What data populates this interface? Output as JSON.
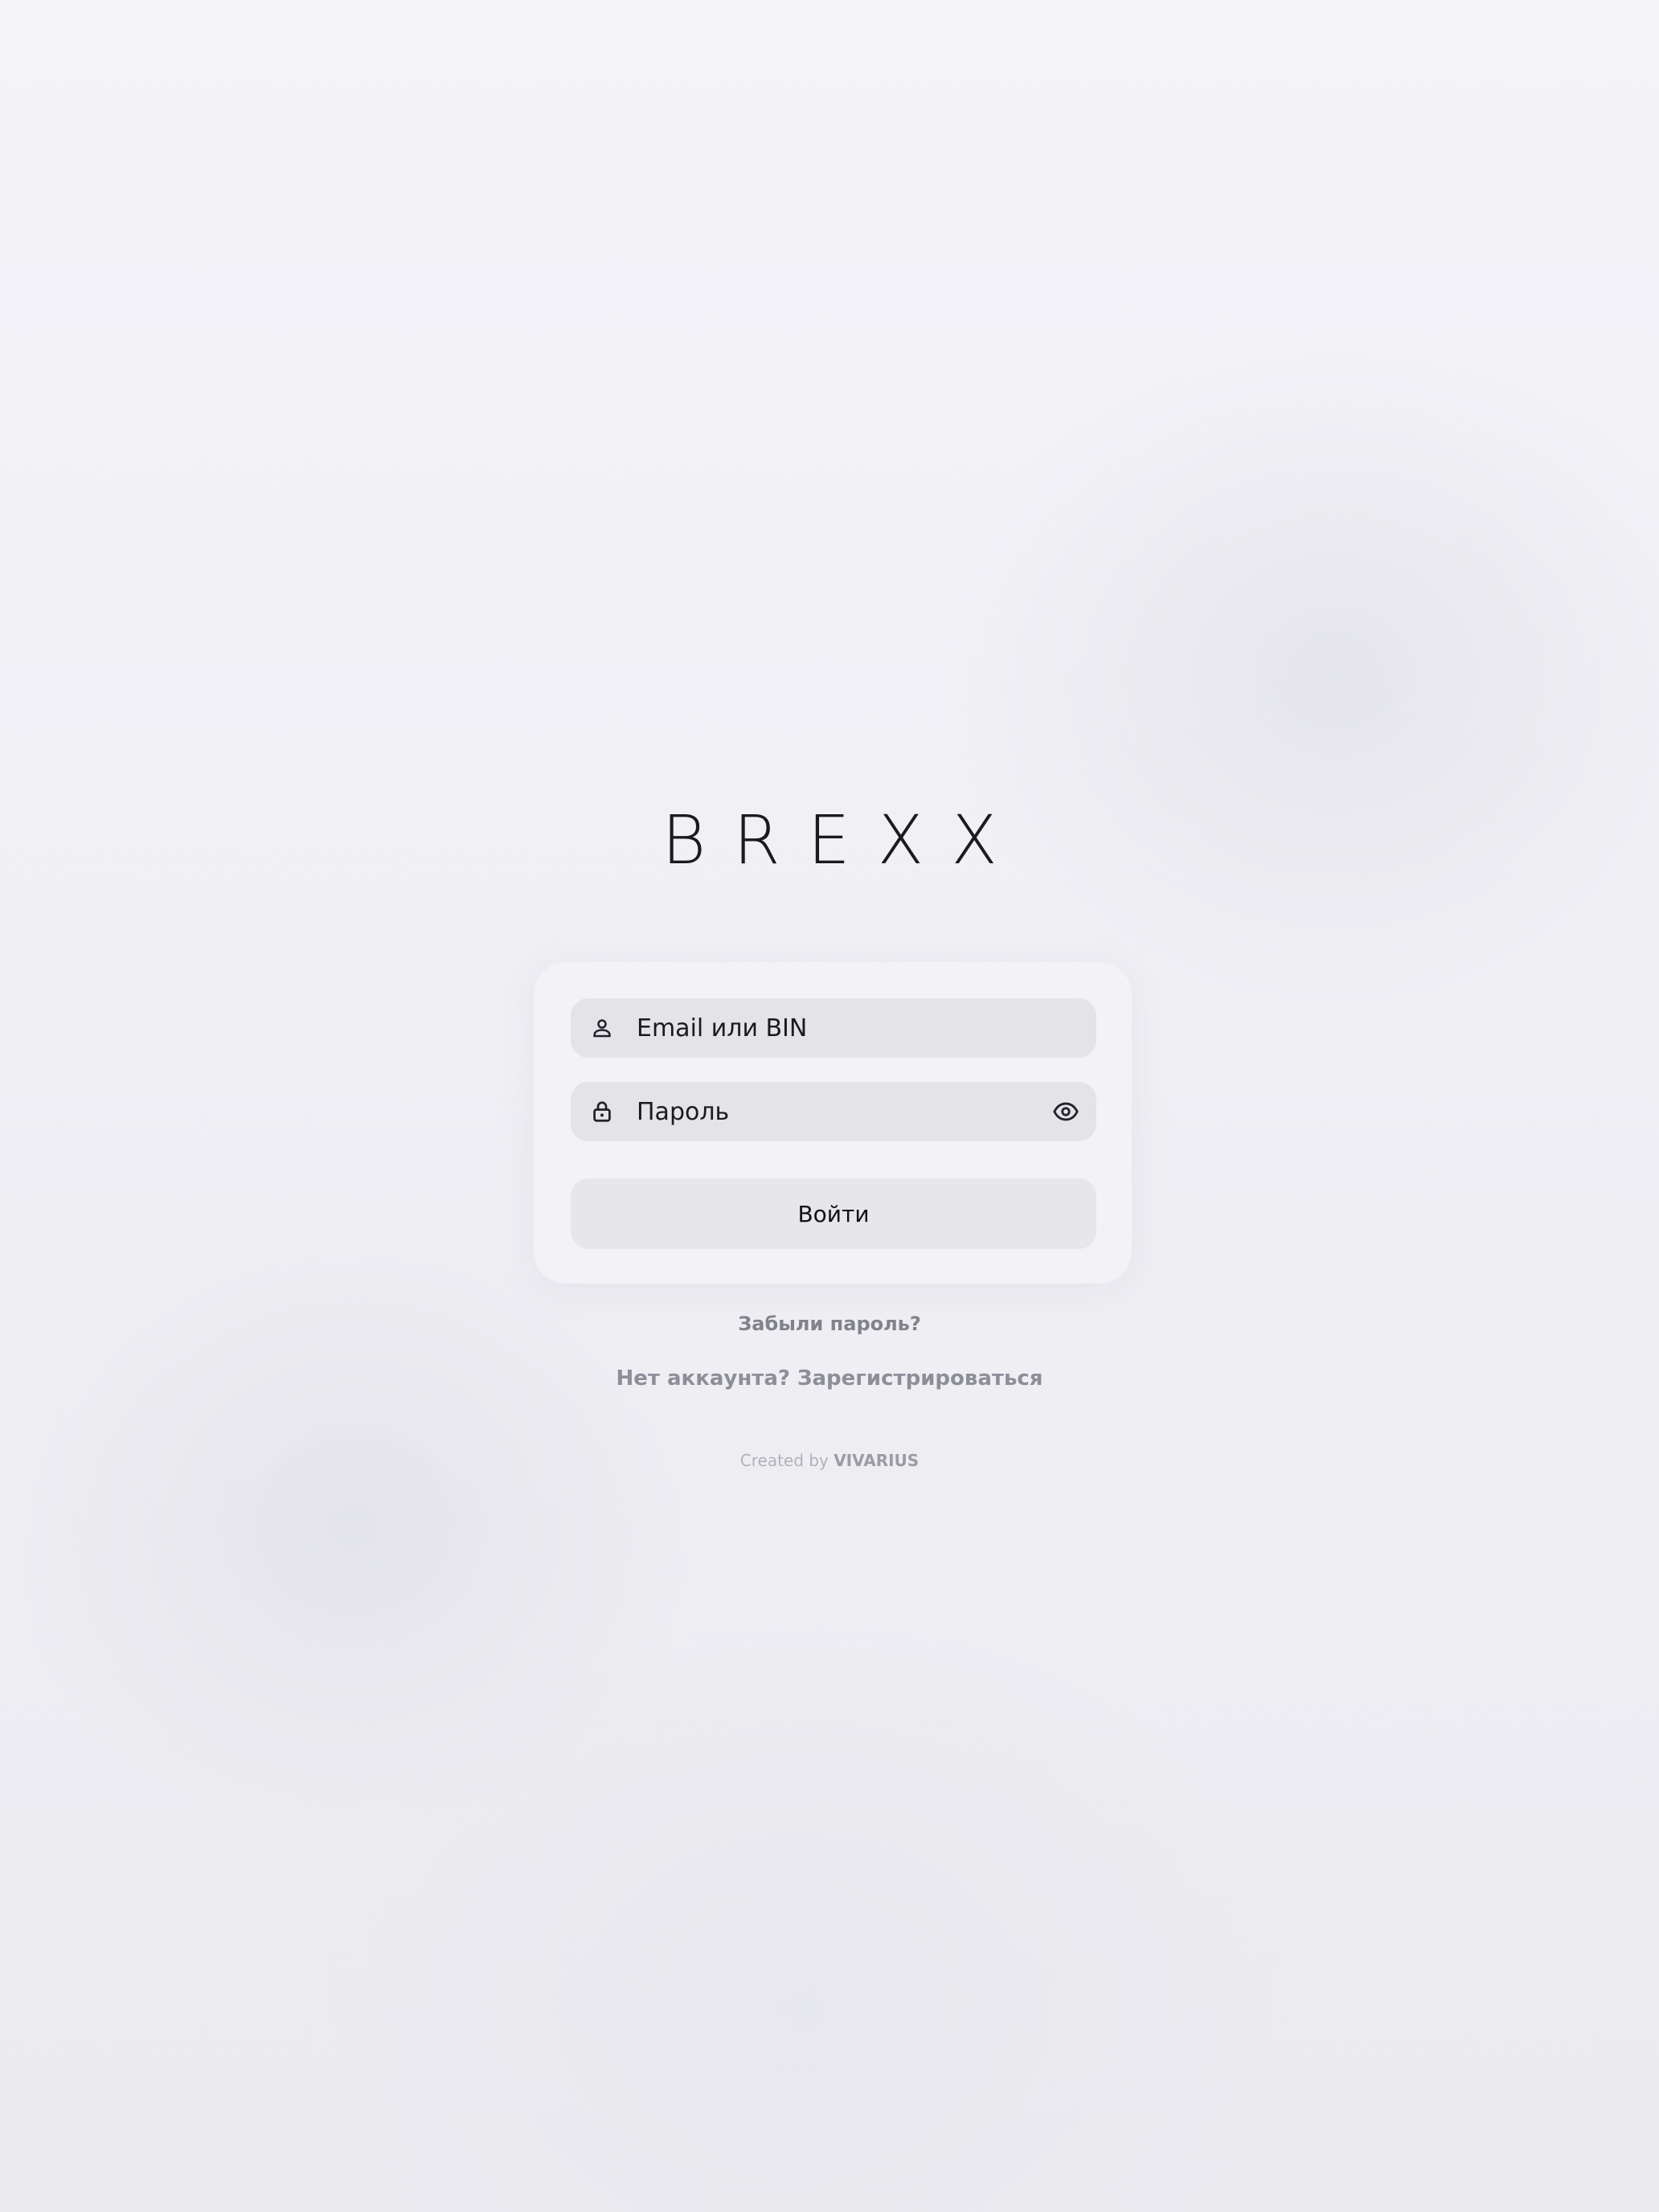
{
  "logo": {
    "text": "BREXX"
  },
  "login_form": {
    "email": {
      "placeholder": "Email или BIN",
      "icon": "person-icon"
    },
    "password": {
      "placeholder": "Пароль",
      "icon": "lock-icon",
      "toggle_icon": "eye-icon"
    },
    "submit_label": "Войти"
  },
  "links": {
    "forgot_password": "Забыли пароль?",
    "register": "Нет аккаунта? Зарегистрироваться"
  },
  "footer": {
    "created_by": "Created by",
    "brand": "VIVARIUS"
  },
  "colors": {
    "background": "#efeff4",
    "field_background": "#e3e3e8",
    "text": "#1a1a1f",
    "link": "#82828c"
  }
}
